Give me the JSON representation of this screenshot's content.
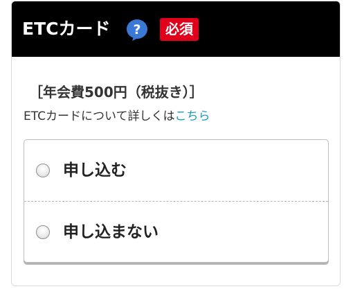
{
  "header": {
    "title": "ETCカード",
    "help_icon": "question-bubble-icon",
    "required_badge": "必須",
    "colors": {
      "background": "#000000",
      "help_icon": "#3a78d6",
      "badge": "#e0001b"
    }
  },
  "fee": {
    "label": "［年会費500円（税抜き）］"
  },
  "detail": {
    "text": "ETCカードについて詳しくは",
    "link_text": "こちら",
    "link_color": "#1a9bb8"
  },
  "options": {
    "items": [
      {
        "label": "申し込む",
        "selected": false
      },
      {
        "label": "申し込まない",
        "selected": false
      }
    ]
  }
}
